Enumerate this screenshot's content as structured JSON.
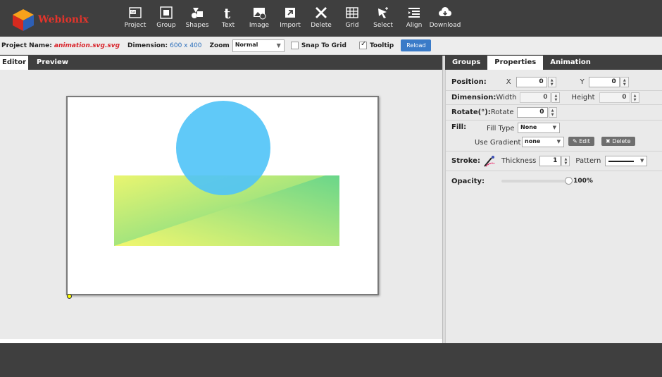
{
  "app": {
    "brand": "Webionix"
  },
  "toolbar": {
    "items": [
      {
        "label": "Project",
        "icon": "svg-file-icon"
      },
      {
        "label": "Group",
        "icon": "group-icon"
      },
      {
        "label": "Shapes",
        "icon": "shapes-icon"
      },
      {
        "label": "Text",
        "icon": "text-icon"
      },
      {
        "label": "Image",
        "icon": "image-icon"
      },
      {
        "label": "Import",
        "icon": "import-icon"
      },
      {
        "label": "Delete",
        "icon": "delete-icon"
      },
      {
        "label": "Grid",
        "icon": "grid-icon"
      },
      {
        "label": "Select",
        "icon": "select-cursor-icon"
      },
      {
        "label": "Align",
        "icon": "align-icon"
      },
      {
        "label": "Download",
        "icon": "cloud-download-icon"
      }
    ]
  },
  "options": {
    "project_label": "Project Name:",
    "project_name": "animation.svg.svg",
    "dimension_label": "Dimension:",
    "dimension_value": "600 x 400",
    "zoom_label": "Zoom",
    "zoom_value": "Normal",
    "snap_label": "Snap To Grid",
    "snap_checked": false,
    "tooltip_label": "Tooltip",
    "tooltip_checked": true,
    "reload_label": "Reload"
  },
  "editor_tabs": {
    "editor": "Editor",
    "preview": "Preview"
  },
  "right_tabs": {
    "groups": "Groups",
    "properties": "Properties",
    "animation": "Animation"
  },
  "properties": {
    "position_label": "Position:",
    "x_label": "X",
    "x_value": "0",
    "y_label": "Y",
    "y_value": "0",
    "dimension_label": "Dimension:",
    "width_label": "Width",
    "width_value": "0",
    "height_label": "Height",
    "height_value": "0",
    "rotate_label": "Rotate(°):",
    "rotate_sub": "Rotate",
    "rotate_value": "0",
    "fill_label": "Fill:",
    "fill_type_label": "Fill Type",
    "fill_type_value": "None",
    "gradient_label": "Use Gradient",
    "gradient_value": "none",
    "edit_label": "Edit",
    "delete_label": "Delete",
    "stroke_label": "Stroke:",
    "thickness_label": "Thickness",
    "thickness_value": "1",
    "pattern_label": "Pattern",
    "opacity_label": "Opacity:",
    "opacity_value": "100%",
    "opacity_fraction": 1.0
  },
  "colors": {
    "circle": "#4fc3f7",
    "gradient_yellow": "#f4f77a",
    "gradient_green": "#6ad68a",
    "accent_blue": "#3a7bc8",
    "brand_red": "#e4342b"
  }
}
